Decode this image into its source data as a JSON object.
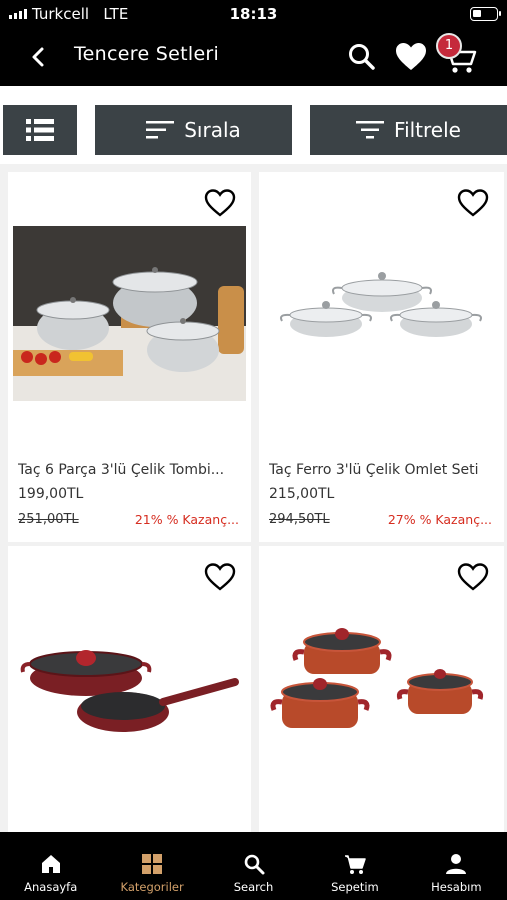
{
  "status_bar": {
    "carrier": "Turkcell",
    "network": "LTE",
    "time": "18:13"
  },
  "header": {
    "title": "Tencere Setleri",
    "cart_count": "1"
  },
  "toolbar": {
    "sort_label": "Sırala",
    "filter_label": "Filtrele"
  },
  "products": [
    {
      "name": "Taç 6 Parça 3'lü Çelik Tombi...",
      "price": "199,00TL",
      "old_price": "251,00TL",
      "discount": "21% % Kazanç..."
    },
    {
      "name": "Taç Ferro 3'lü Çelik Omlet Seti",
      "price": "215,00TL",
      "old_price": "294,50TL",
      "discount": "27% % Kazanç..."
    },
    {
      "name": "",
      "price": "",
      "old_price": "",
      "discount": ""
    },
    {
      "name": "",
      "price": "",
      "old_price": "",
      "discount": ""
    }
  ],
  "bottom_nav": [
    {
      "label": "Anasayfa",
      "icon": "home-icon"
    },
    {
      "label": "Kategoriler",
      "icon": "categories-icon"
    },
    {
      "label": "Search",
      "icon": "search-icon"
    },
    {
      "label": "Sepetim",
      "icon": "cart-icon"
    },
    {
      "label": "Hesabım",
      "icon": "person-icon"
    }
  ],
  "colors": {
    "accent": "#d2a06a",
    "badge": "#c5293b",
    "discount": "#d62d20",
    "toolbar_button": "#3b4246"
  }
}
